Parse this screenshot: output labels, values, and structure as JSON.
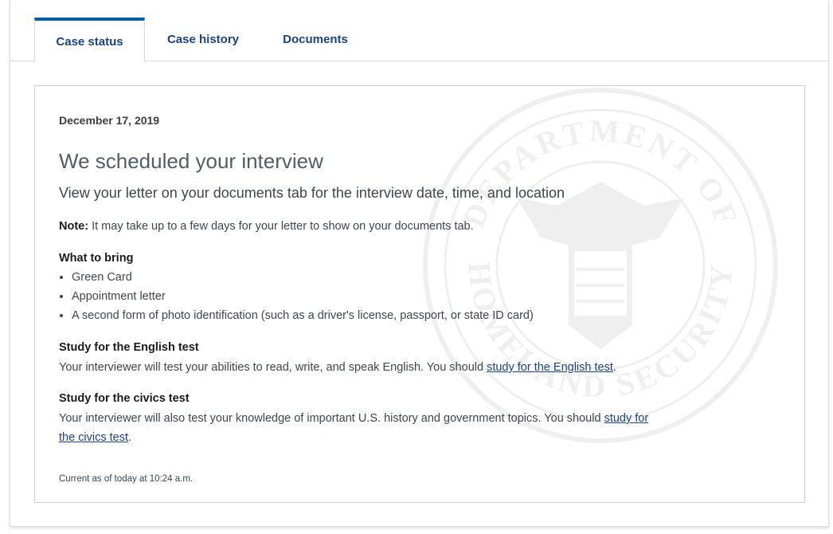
{
  "tabs": [
    {
      "label": "Case status",
      "active": true
    },
    {
      "label": "Case history",
      "active": false
    },
    {
      "label": "Documents",
      "active": false
    }
  ],
  "status": {
    "date": "December 17, 2019",
    "title": "We scheduled your interview",
    "subtitle": "View your letter on your documents tab for the interview date, time, and location",
    "note_label": "Note:",
    "note_text": " It may take up to a few days for your letter to show on your documents tab.",
    "bring_heading": "What to bring",
    "bring_items": [
      "Green Card",
      "Appointment letter",
      "A second form of photo identification (such as a driver's license, passport, or state ID card)"
    ],
    "english": {
      "heading": "Study for the English test",
      "text": "Your interviewer will test your abilities to read, write, and speak English. You should ",
      "link": "study for the English test",
      "after": "."
    },
    "civics": {
      "heading": "Study for the civics test",
      "text": "Your interviewer will also test your knowledge of important U.S. history and government topics. You should ",
      "link": "study for the civics test",
      "after": "."
    },
    "footer": "Current as of today at 10:24 a.m."
  },
  "watermark": {
    "top_text": "DEPARTMENT OF",
    "bottom_text": "HOMELAND SECURITY"
  },
  "colors": {
    "tab_text": "#1a4480",
    "tab_active_border": "#005ea2",
    "link": "#1a4480"
  }
}
